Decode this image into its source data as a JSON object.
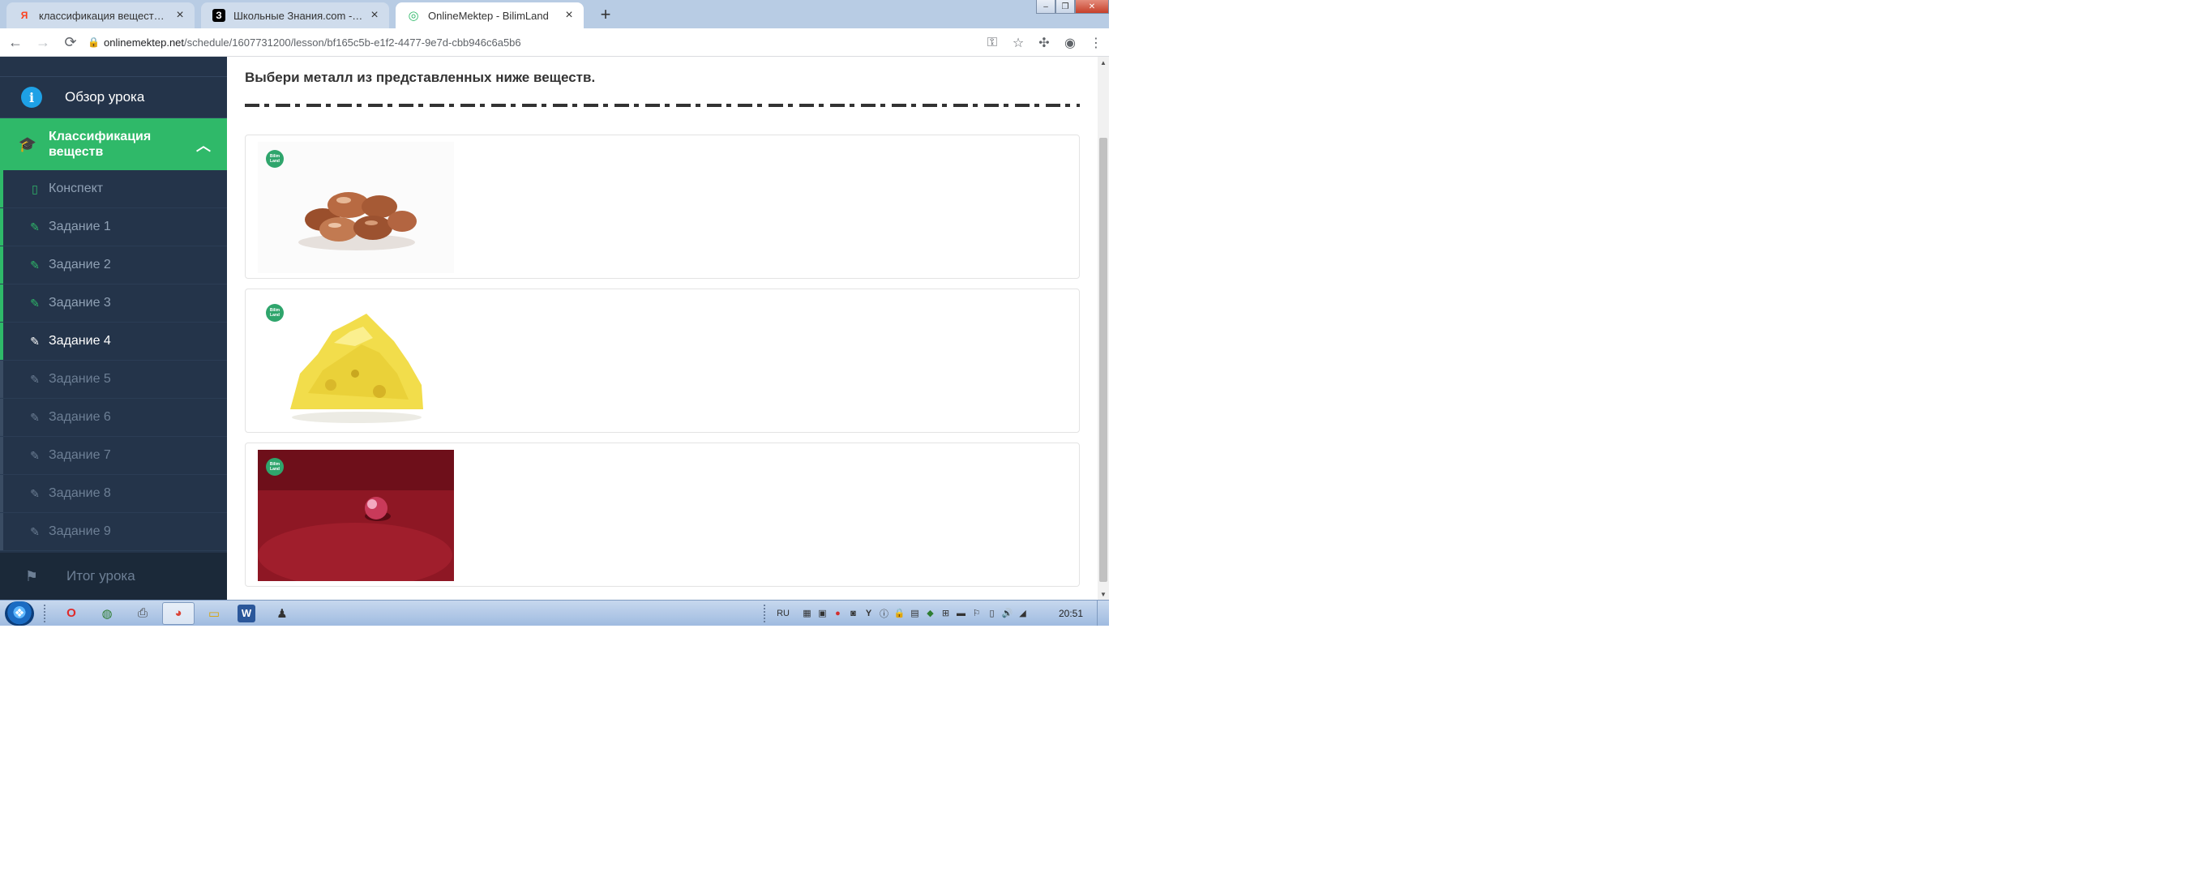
{
  "browser": {
    "tabs": [
      {
        "title": "классификация веществ какой",
        "favicon": "Я",
        "favicon_color": "#fc3f1d",
        "active": false
      },
      {
        "title": "Школьные Знания.com - Решаю",
        "favicon": "З",
        "favicon_color": "#000000",
        "active": false
      },
      {
        "title": "OnlineMektep - BilimLand",
        "favicon": "◎",
        "favicon_color": "#2fb969",
        "active": true
      }
    ],
    "url_host": "onlinemektep.net",
    "url_path": "/schedule/1607731200/lesson/bf165c5b-e1f2-4477-9e7d-cbb946c6a5b6"
  },
  "sidebar": {
    "overview_label": "Обзор урока",
    "section_label": "Классификация веществ",
    "items": [
      {
        "label": "Конспект",
        "state": "done",
        "icon": "book-icon"
      },
      {
        "label": "Задание 1",
        "state": "done",
        "icon": "edit-icon"
      },
      {
        "label": "Задание 2",
        "state": "done",
        "icon": "edit-icon"
      },
      {
        "label": "Задание 3",
        "state": "done",
        "icon": "edit-icon"
      },
      {
        "label": "Задание 4",
        "state": "current",
        "icon": "edit-icon"
      },
      {
        "label": "Задание 5",
        "state": "pending",
        "icon": "edit-icon"
      },
      {
        "label": "Задание 6",
        "state": "pending",
        "icon": "edit-icon"
      },
      {
        "label": "Задание 7",
        "state": "pending",
        "icon": "edit-icon"
      },
      {
        "label": "Задание 8",
        "state": "pending",
        "icon": "edit-icon"
      },
      {
        "label": "Задание 9",
        "state": "pending",
        "icon": "edit-icon"
      }
    ],
    "final_label": "Итог урока"
  },
  "content": {
    "question": "Выбери металл из представленных ниже веществ.",
    "options": [
      {
        "image": "copper-nuggets-image"
      },
      {
        "image": "sulfur-lump-image"
      },
      {
        "image": "red-bead-on-red-cloth-image"
      }
    ]
  },
  "taskbar": {
    "lang": "RU",
    "clock": "20:51"
  },
  "colors": {
    "accent_green": "#2fb969",
    "sidebar_bg": "#24344a",
    "info_blue": "#1ea1e6"
  }
}
